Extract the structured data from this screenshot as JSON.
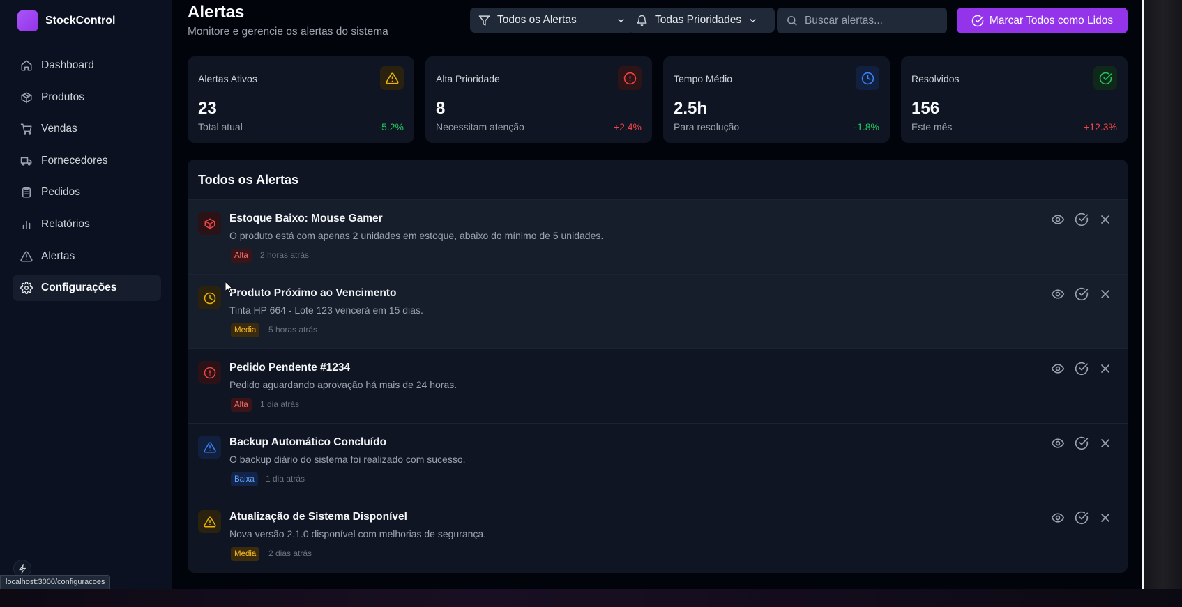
{
  "app": {
    "name": "StockControl",
    "status_url": "localhost:3000/configuracoes"
  },
  "sidebar": {
    "items": [
      {
        "label": "Dashboard",
        "icon": "home-icon"
      },
      {
        "label": "Produtos",
        "icon": "package-icon"
      },
      {
        "label": "Vendas",
        "icon": "cart-icon"
      },
      {
        "label": "Fornecedores",
        "icon": "truck-icon"
      },
      {
        "label": "Pedidos",
        "icon": "clipboard-icon"
      },
      {
        "label": "Relatórios",
        "icon": "bar-chart-icon"
      },
      {
        "label": "Alertas",
        "icon": "warning-icon"
      },
      {
        "label": "Configurações",
        "icon": "gear-icon",
        "active": true
      }
    ]
  },
  "header": {
    "title": "Alertas",
    "subtitle": "Monitore e gerencie os alertas do sistema",
    "filter_type": "Todos os Alertas",
    "filter_priority": "Todas Prioridades",
    "search_placeholder": "Buscar alertas...",
    "mark_all_label": "Marcar Todos como Lidos"
  },
  "stats": [
    {
      "label": "Alertas Ativos",
      "value": "23",
      "sub": "Total atual",
      "change": "-5.2%",
      "change_color": "#22c55e",
      "icon": "warning-icon",
      "icon_color": "#eab308"
    },
    {
      "label": "Alta Prioridade",
      "value": "8",
      "sub": "Necessitam atenção",
      "change": "+2.4%",
      "change_color": "#ef4444",
      "icon": "alert-circle-icon",
      "icon_color": "#ef4444"
    },
    {
      "label": "Tempo Médio",
      "value": "2.5h",
      "sub": "Para resolução",
      "change": "-1.8%",
      "change_color": "#22c55e",
      "icon": "clock-icon",
      "icon_color": "#3b82f6"
    },
    {
      "label": "Resolvidos",
      "value": "156",
      "sub": "Este mês",
      "change": "+12.3%",
      "change_color": "#ef4444",
      "icon": "check-circle-icon",
      "icon_color": "#22c55e"
    }
  ],
  "alerts_panel": {
    "title": "Todos os Alertas",
    "items": [
      {
        "title": "Estoque Baixo: Mouse Gamer",
        "description": "O produto está com apenas 2 unidades em estoque, abaixo do mínimo de 5 unidades.",
        "priority": "Alta",
        "time": "2 horas atrás",
        "icon": "package-icon",
        "icon_color": "#ef4444"
      },
      {
        "title": "Produto Próximo ao Vencimento",
        "description": "Tinta HP 664 - Lote 123 vencerá em 15 dias.",
        "priority": "Media",
        "time": "5 horas atrás",
        "icon": "clock-icon",
        "icon_color": "#eab308"
      },
      {
        "title": "Pedido Pendente #1234",
        "description": "Pedido aguardando aprovação há mais de 24 horas.",
        "priority": "Alta",
        "time": "1 dia atrás",
        "icon": "alert-circle-icon",
        "icon_color": "#ef4444"
      },
      {
        "title": "Backup Automático Concluído",
        "description": "O backup diário do sistema foi realizado com sucesso.",
        "priority": "Baixa",
        "time": "1 dia atrás",
        "icon": "warning-icon",
        "icon_color": "#3b82f6"
      },
      {
        "title": "Atualização de Sistema Disponível",
        "description": "Nova versão 2.1.0 disponível com melhorias de segurança.",
        "priority": "Media",
        "time": "2 dias atrás",
        "icon": "warning-icon",
        "icon_color": "#eab308"
      }
    ]
  }
}
